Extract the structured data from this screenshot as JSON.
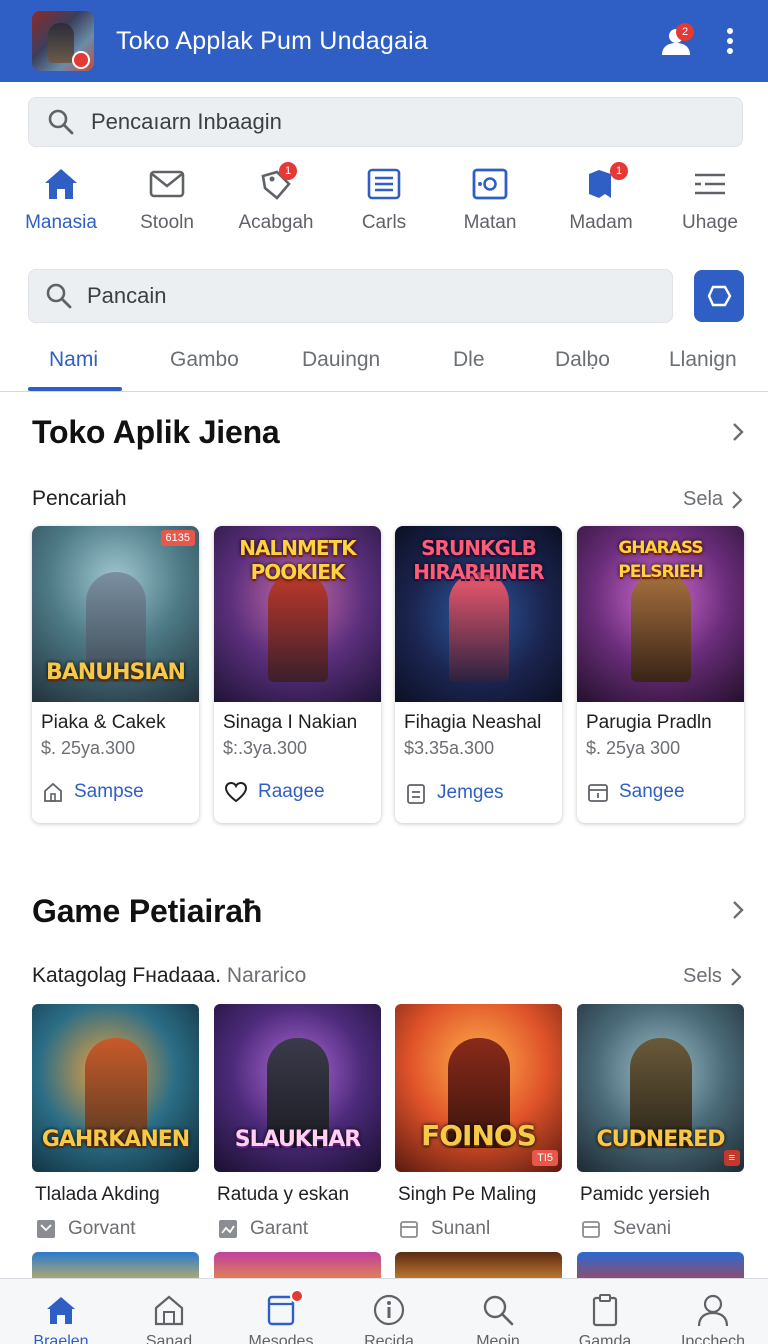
{
  "appbar": {
    "title": "Toko Applak Pum Undagaia",
    "notification_count": "2",
    "brand_color": "#2f5fc4"
  },
  "search_top": {
    "placeholder": "Pencaıarn  Inbaagin"
  },
  "categories": [
    {
      "label": "Manasia",
      "icon": "home-icon",
      "active": true
    },
    {
      "label": "Stooln",
      "icon": "mail-icon"
    },
    {
      "label": "Acabgah",
      "icon": "tag-icon",
      "badge": "1"
    },
    {
      "label": "Carls",
      "icon": "list-icon"
    },
    {
      "label": "Matan",
      "icon": "camera-icon"
    },
    {
      "label": "Madam",
      "icon": "bookmark-icon",
      "badge": "1"
    },
    {
      "label": "Uhage",
      "icon": "menu-icon"
    }
  ],
  "search_second": {
    "placeholder": "Pancain"
  },
  "tabs": [
    "Nami",
    "Gambo",
    "Dauingn",
    "Dle",
    "Dalḅo",
    "Llanign"
  ],
  "section1": {
    "title": "Toko Aplik Jiena",
    "subtitle": "Pencariah",
    "see_all": "Sela",
    "cards": [
      {
        "art_title": "BANUHSIAN",
        "tag": "6135",
        "name": "Piaka & Cakek",
        "price": "$. 25ya.300",
        "action": "Sampse",
        "action_icon": "home-outline-icon"
      },
      {
        "art_title": "NALNMETK POOKIEK",
        "name": "Sinaga I Nakian",
        "price": "$:.3ya.300",
        "action": "Raagee",
        "action_icon": "heart-icon"
      },
      {
        "art_title": "SRUNKGLB HIRARHINER",
        "name": "Fihagia Neashal",
        "price": "$3.35a.300",
        "action": "Jemges",
        "action_icon": "clipboard-icon"
      },
      {
        "art_title": "GHARASS PELSRIEH",
        "name": "Parugia Pradln",
        "price": "$. 25ya 300",
        "action": "Sangee",
        "action_icon": "calendar-icon"
      }
    ]
  },
  "section2": {
    "title": "Game Petiairaħ",
    "subtitle": "Katagolag Fнadaaa.",
    "subtitle_muted": "Nararico",
    "see_all": "Sels",
    "games": [
      {
        "art_title": "GAHRKANEN",
        "name": "Tlalada Akding",
        "meta": "Gorvant",
        "meta_icon": "chat-icon"
      },
      {
        "art_title": "SLAUKHAR",
        "name": "Ratuda y eskan",
        "meta": "Garant",
        "meta_icon": "image-icon"
      },
      {
        "art_title": "FOINOS",
        "tag": "TI5",
        "name": "Singh Pe Maling",
        "meta": "Sunanl",
        "meta_icon": "calendar-icon"
      },
      {
        "art_title": "CUDNERED",
        "name": "Pamidc yersieh",
        "meta": "Sevani",
        "meta_icon": "calendar-icon"
      }
    ]
  },
  "bottomnav": [
    {
      "label": "Braelen",
      "icon": "home-icon",
      "active": true
    },
    {
      "label": "Sanad",
      "icon": "store-icon"
    },
    {
      "label": "Mesodes",
      "icon": "tablet-icon",
      "dot": true
    },
    {
      "label": "Recida",
      "icon": "info-icon"
    },
    {
      "label": "Meoin",
      "icon": "search-icon"
    },
    {
      "label": "Gamda",
      "icon": "clipboard-icon"
    },
    {
      "label": "Ipcchech",
      "icon": "profile-icon"
    }
  ]
}
